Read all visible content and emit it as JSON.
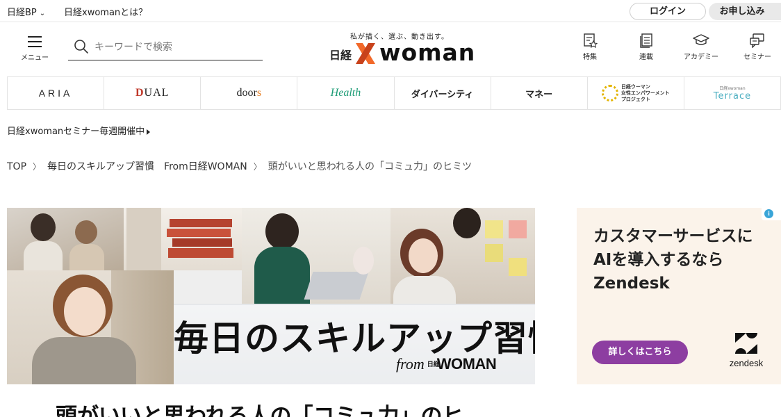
{
  "topbar": {
    "bp_link": "日経BP",
    "about_link": "日経xwomanとは？",
    "login": "ログイン",
    "apply": "お申し込み"
  },
  "header": {
    "menu_label": "メニュー",
    "search_placeholder": "キーワードで検索",
    "tagline": "私が描く、選ぶ、動き出す。",
    "logo_nikkei": "日経",
    "logo_woman": "woman",
    "nav": [
      {
        "label": "特集",
        "icon": "feature-star-icon"
      },
      {
        "label": "連載",
        "icon": "serial-document-icon"
      },
      {
        "label": "アカデミー",
        "icon": "academy-cap-icon"
      },
      {
        "label": "セミナー",
        "icon": "seminar-chat-icon"
      }
    ]
  },
  "categories": {
    "aria": "ARIA",
    "dual_d": "D",
    "dual_rest": "UAL",
    "doors_main": "door",
    "doors_s": "s",
    "health": "Health",
    "diversity": "ダイバーシティ",
    "money": "マネー",
    "award_line1": "日経ウーマン",
    "award_line2": "女性エンパワーメント",
    "award_line3": "プロジェクト",
    "terrace_small": "日経xwoman",
    "terrace": "Terrace"
  },
  "notice": "日経xwomanセミナー毎週開催中",
  "breadcrumb": {
    "items": [
      "TOP",
      "毎日のスキルアップ習慣　From日経WOMAN"
    ],
    "current": "頭がいいと思われる人の「コミュ力」のヒミツ"
  },
  "hero": {
    "title": "毎日のスキルアップ習慣",
    "sub_from": "from",
    "sub_nikkei": "日経",
    "sub_woman": "WOMAN"
  },
  "article": {
    "title": "頭がいいと思われる人の「コミュ力」のヒ"
  },
  "ad": {
    "info": "i",
    "line1": "カスタマーサービスに",
    "line2": "AIを導入するなら",
    "line3": "Zendesk",
    "cta": "詳しくはこちら",
    "brand": "zendesk"
  },
  "colors": {
    "accent_orange": "#f2692a",
    "health_green": "#1d9c76",
    "ad_purple": "#8d3ea1",
    "terrace_teal": "#4aaec0"
  }
}
